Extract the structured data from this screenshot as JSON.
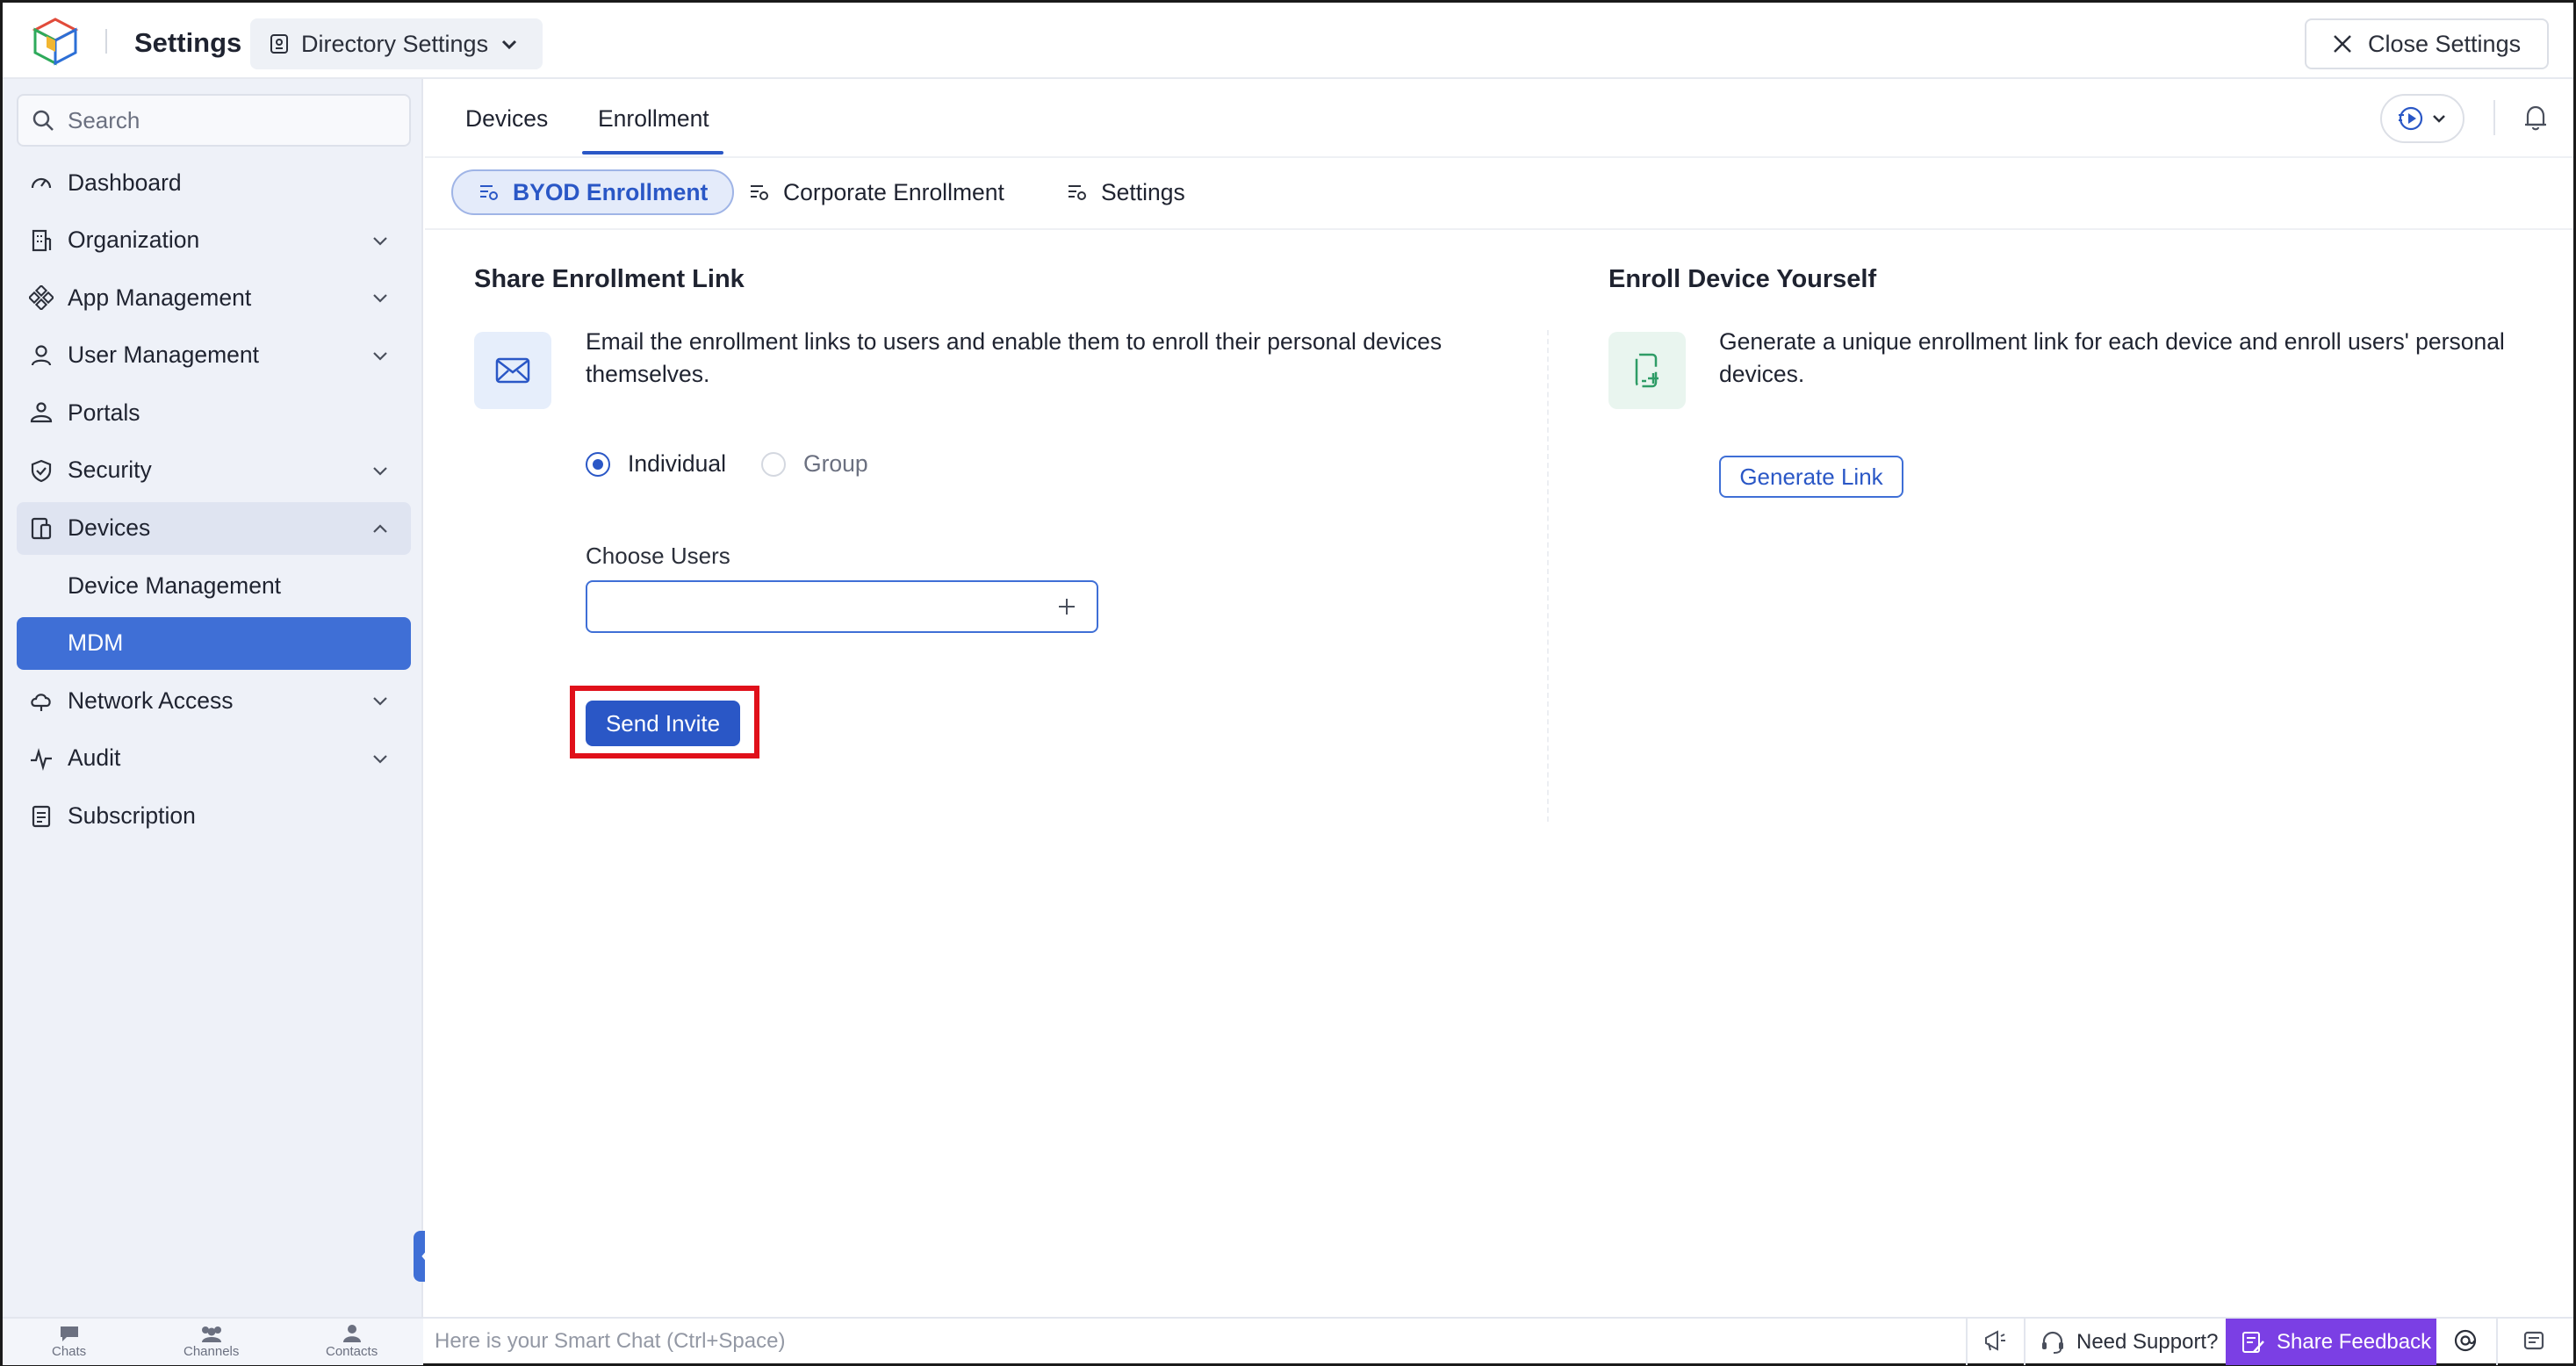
{
  "topbar": {
    "title": "Settings",
    "directory_button": "Directory Settings",
    "close_button": "Close Settings"
  },
  "sidebar": {
    "search_placeholder": "Search",
    "items": [
      {
        "label": "Dashboard",
        "icon": "dashboard-icon"
      },
      {
        "label": "Organization",
        "icon": "organization-icon",
        "expandable": true
      },
      {
        "label": "App Management",
        "icon": "app-management-icon",
        "expandable": true
      },
      {
        "label": "User Management",
        "icon": "user-icon",
        "expandable": true
      },
      {
        "label": "Portals",
        "icon": "portals-icon"
      },
      {
        "label": "Security",
        "icon": "shield-icon",
        "expandable": true
      },
      {
        "label": "Devices",
        "icon": "devices-icon",
        "expandable": true,
        "expanded": true
      },
      {
        "label": "Device Management",
        "sub": true
      },
      {
        "label": "MDM",
        "sub": true,
        "active": true
      },
      {
        "label": "Network Access",
        "icon": "cloud-icon",
        "expandable": true
      },
      {
        "label": "Audit",
        "icon": "audit-icon",
        "expandable": true
      },
      {
        "label": "Subscription",
        "icon": "subscription-icon"
      }
    ]
  },
  "main": {
    "tabs": [
      {
        "label": "Devices"
      },
      {
        "label": "Enrollment",
        "active": true
      }
    ],
    "subtabs": [
      {
        "label": "BYOD Enrollment",
        "active": true
      },
      {
        "label": "Corporate Enrollment"
      },
      {
        "label": "Settings"
      }
    ],
    "share": {
      "title": "Share Enrollment Link",
      "desc_line1": "Email the enrollment links to users and enable them to enroll their personal devices",
      "desc_line2": "themselves.",
      "radio_individual": "Individual",
      "radio_group": "Group",
      "selected": "Individual",
      "choose_users_label": "Choose Users",
      "choose_users_value": "",
      "send_button": "Send Invite"
    },
    "enroll": {
      "title": "Enroll Device Yourself",
      "desc_line1": "Generate a unique enrollment link for each device and enroll users' personal",
      "desc_line2": "devices.",
      "generate_button": "Generate Link"
    }
  },
  "bottombar": {
    "chats": "Chats",
    "channels": "Channels",
    "contacts": "Contacts",
    "smart_chat_placeholder": "Here is your Smart Chat (Ctrl+Space)",
    "need_support": "Need Support?",
    "share_feedback": "Share Feedback"
  },
  "colors": {
    "accent": "#2a57c6",
    "sidebar_bg": "#eef1f8",
    "active_nav": "#3f6fd6",
    "highlight": "#e0101a",
    "feedback": "#7b3fe4"
  }
}
